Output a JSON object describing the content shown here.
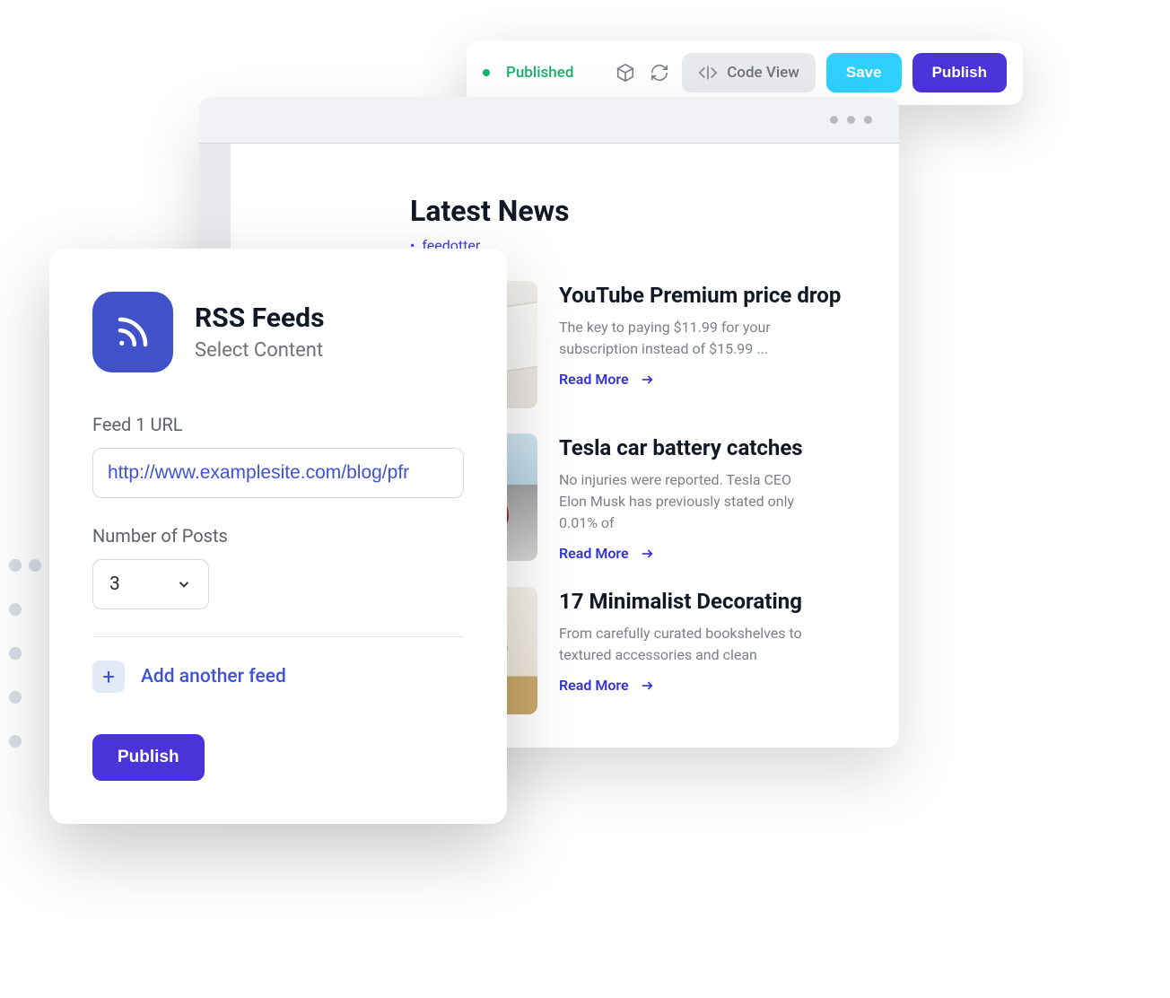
{
  "toolbar": {
    "status": "Published",
    "codeview_label": "Code View",
    "save_label": "Save",
    "publish_label": "Publish"
  },
  "preview": {
    "heading": "Latest News",
    "tag": "feedotter",
    "readmore_label": "Read More",
    "items": [
      {
        "title": "YouTube Premium price drop",
        "excerpt": "The key to paying $11.99 for your subscription instead of $15.99 ..."
      },
      {
        "title": "Tesla car battery catches",
        "excerpt": "No injuries were reported. Tesla CEO Elon Musk has previously stated only 0.01% of"
      },
      {
        "title": "17 Minimalist Decorating",
        "excerpt": "From carefully curated bookshelves to textured accessories and clean"
      }
    ]
  },
  "rss": {
    "title": "RSS Feeds",
    "subtitle": "Select Content",
    "feed_url_label": "Feed 1 URL",
    "feed_url_value": "http://www.examplesite.com/blog/pfr",
    "num_posts_label": "Number of Posts",
    "num_posts_value": "3",
    "add_feed_label": "Add another feed",
    "publish_label": "Publish"
  }
}
